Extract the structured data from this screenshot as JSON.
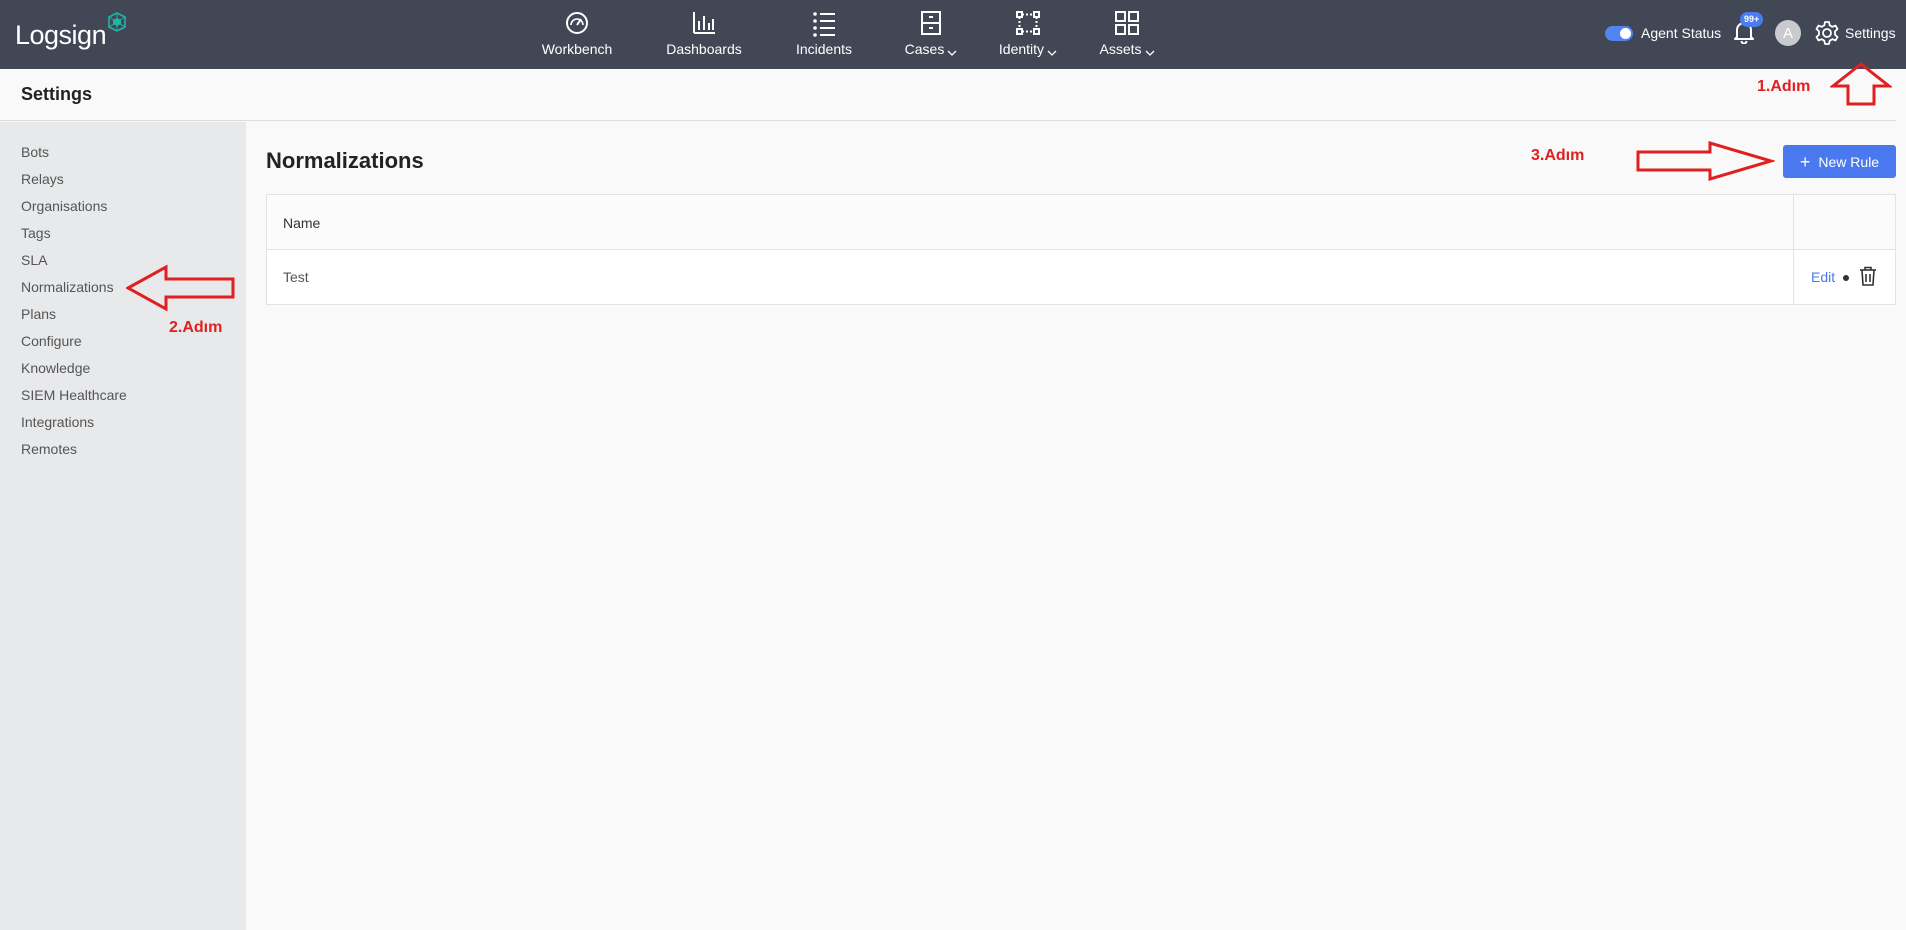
{
  "app": {
    "logo_text": "Logsign"
  },
  "nav": {
    "items": [
      {
        "label": "Workbench",
        "icon": "gauge-icon"
      },
      {
        "label": "Dashboards",
        "icon": "bar-chart-icon"
      },
      {
        "label": "Incidents",
        "icon": "list-icon"
      },
      {
        "label": "Cases",
        "icon": "drawer-icon",
        "dropdown": true
      },
      {
        "label": "Identity",
        "icon": "identity-icon",
        "dropdown": true
      },
      {
        "label": "Assets",
        "icon": "grid-icon",
        "dropdown": true
      }
    ]
  },
  "header_right": {
    "agent_status_label": "Agent Status",
    "notification_badge": "99+",
    "avatar_initial": "A",
    "settings_label": "Settings"
  },
  "page": {
    "title": "Settings"
  },
  "sidebar": {
    "items": [
      {
        "label": "Bots"
      },
      {
        "label": "Relays"
      },
      {
        "label": "Organisations"
      },
      {
        "label": "Tags"
      },
      {
        "label": "SLA"
      },
      {
        "label": "Normalizations"
      },
      {
        "label": "Plans"
      },
      {
        "label": "Configure"
      },
      {
        "label": "Knowledge"
      },
      {
        "label": "SIEM Healthcare"
      },
      {
        "label": "Integrations"
      },
      {
        "label": "Remotes"
      }
    ]
  },
  "main": {
    "title": "Normalizations",
    "new_rule_label": "New Rule",
    "table": {
      "columns": [
        "Name",
        ""
      ],
      "rows": [
        {
          "name": "Test",
          "edit_label": "Edit"
        }
      ]
    }
  },
  "annotations": {
    "step1": "1.Adım",
    "step2": "2.Adım",
    "step3": "3.Adım"
  },
  "colors": {
    "topbar": "#424756",
    "accent": "#4a79ef",
    "annotation": "#e02020"
  }
}
